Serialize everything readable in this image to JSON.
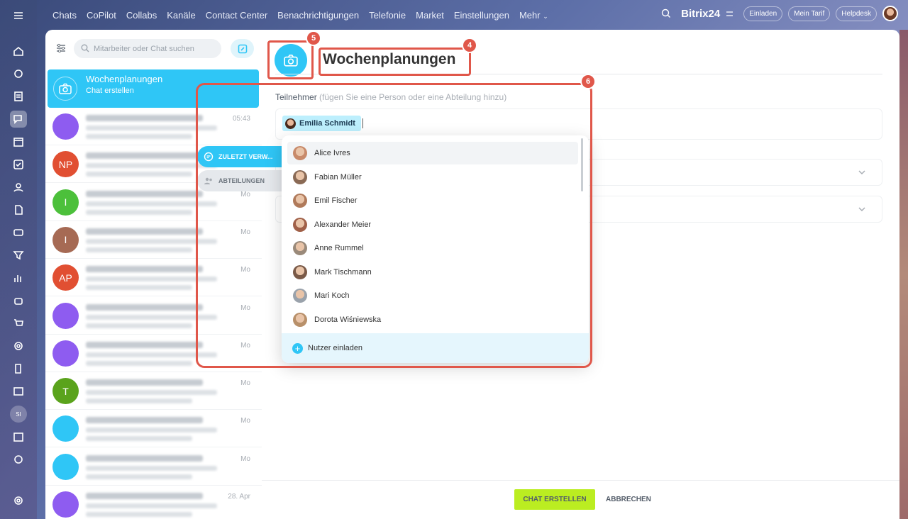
{
  "topnav": {
    "items": [
      "Chats",
      "CoPilot",
      "Collabs",
      "Kanäle",
      "Contact Center",
      "Benachrichtigungen",
      "Telefonie",
      "Market",
      "Einstellungen",
      "Mehr"
    ],
    "brand": "Bitrix24",
    "invite": "Einladen",
    "tariff": "Mein Tarif",
    "help": "Helpdesk"
  },
  "rail": {
    "user_initials": "SI"
  },
  "list": {
    "search_placeholder": "Mitarbeiter oder Chat suchen",
    "selected": {
      "title": "Wochenplanungen",
      "subtitle": "Chat erstellen"
    },
    "rows": [
      {
        "initials": "",
        "time": "05:43",
        "color": "#8e5cf0"
      },
      {
        "initials": "NP",
        "time": "",
        "color": "#e14f32"
      },
      {
        "initials": "I",
        "time": "Mo",
        "color": "#4cc03b"
      },
      {
        "initials": "I",
        "time": "Mo",
        "color": "#a66a54"
      },
      {
        "initials": "AP",
        "time": "Mo",
        "color": "#e14f32"
      },
      {
        "initials": "",
        "time": "Mo",
        "color": "#8e5cf0"
      },
      {
        "initials": "",
        "time": "Mo",
        "color": "#8e5cf0"
      },
      {
        "initials": "T",
        "time": "Mo",
        "color": "#5aa31c"
      },
      {
        "initials": "",
        "time": "Mo",
        "color": "#2fc6f6"
      },
      {
        "initials": "",
        "time": "Mo",
        "color": "#2fc6f6"
      },
      {
        "initials": "",
        "time": "28. Apr",
        "color": "#8e5cf0"
      }
    ]
  },
  "main": {
    "title": "Wochenplanungen",
    "participants_label": "Teilnehmer",
    "participants_hint": "(fügen Sie eine Person oder eine Abteilung hinzu)",
    "chip": "Emilia Schmidt",
    "create_button": "CHAT ERSTELLEN",
    "cancel_button": "ABBRECHEN"
  },
  "dialog": {
    "tabs": [
      "ZULETZT VERW...",
      "ABTEILUNGEN"
    ],
    "users": [
      "Alice Ivres",
      "Fabian Müller",
      "Emil Fischer",
      "Alexander Meier",
      "Anne Rummel",
      "Mark Tischmann",
      "Mari Koch",
      "Dorota Wiśniewska"
    ],
    "invite": "Nutzer einladen"
  },
  "callouts": {
    "b4": "4",
    "b5": "5",
    "b6": "6"
  },
  "colors": {
    "accent": "#2fc6f6",
    "create": "#bbed21",
    "callout": "#e0574a"
  }
}
